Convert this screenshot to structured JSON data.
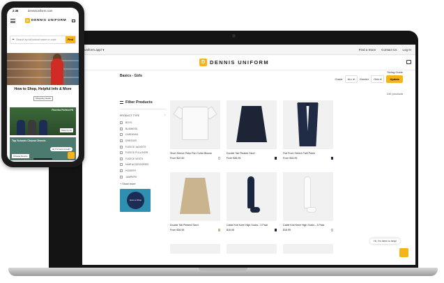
{
  "browser": {
    "address": "uniform.app/ ▾",
    "links": [
      "Find a Store",
      "Contact Us",
      "Log In"
    ]
  },
  "brand": {
    "name": "DENNIS UNIFORM",
    "mark": "D",
    "accent_color": "#f4b41a"
  },
  "page": {
    "title": "Basics - Girls",
    "size_guide": "Sizing Guide",
    "grade_label": "Grade",
    "grade_value": "ALL ▾",
    "gender_label": "Gender",
    "gender_value": "Girls ▾",
    "update_label": "Update",
    "result_count": "249 products"
  },
  "sidebar": {
    "title": "Filter Products",
    "section": "PRODUCT TYPE",
    "items": [
      "BOYS",
      "BUSINESS",
      "CARDIGAN",
      "DRESSES",
      "FLEECE JACKETS",
      "FLEECE PULLOVER",
      "FLEECE VESTS",
      "HAIR ACCESSORIES",
      "HOSIERY",
      "JUMPERS"
    ],
    "show_more": "+ Show more",
    "promo_text": "How to Shop"
  },
  "products": [
    {
      "name": "Short Sleeve Peter Pan Collar Blouse",
      "price": "From $10.50",
      "swatch": "#ffffff"
    },
    {
      "name": "Double Tab Pleated Skort",
      "price": "From $36.95",
      "swatch": "#1c2436"
    },
    {
      "name": "Flat Front Stretch Twill Pants",
      "price": "From $18.95",
      "swatch": "#1f2a44"
    },
    {
      "name": "Double Tab Pleated Skort",
      "price": "From $36.95",
      "swatch": "#c9b48e"
    },
    {
      "name": "Cable Knit Knee High Socks - 3 Pack",
      "price": "$16.95",
      "swatch": "#1a2640"
    },
    {
      "name": "Cable Knit Knee High Socks - 3 Pack",
      "price": "$16.95",
      "swatch": "#f2f2f2"
    }
  ],
  "chat": {
    "label": "Hi, I'm here to help!"
  },
  "phone": {
    "time": "2:36",
    "url": "dennisuniform.com",
    "search_placeholder": "Search by full school name or code",
    "find_label": "Find",
    "hero_title": "How to Shop, Helpful Info & More",
    "shop_button": "Shopping Guide",
    "tile1_label": "Find the Perfect Fit",
    "tile1_button": "Shop by Fit",
    "tile2_label": "Top Schools Choose Dennis",
    "tile2_chat": "Hi, I'm here to help!",
    "tile2_button": "Choose Dennis"
  }
}
